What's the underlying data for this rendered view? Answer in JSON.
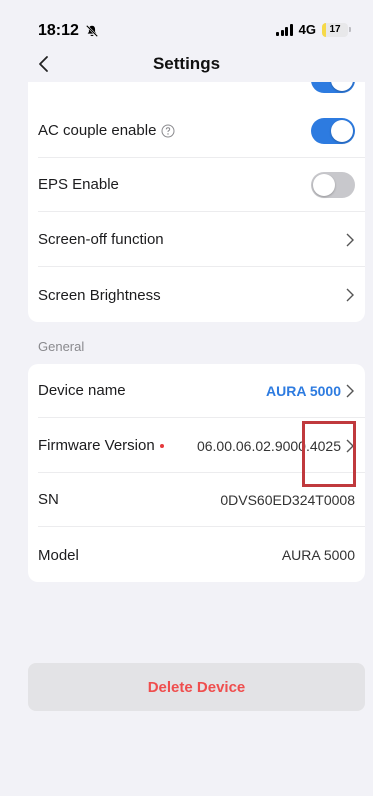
{
  "status_bar": {
    "time": "18:12",
    "network": "4G",
    "battery": "17",
    "battery_level": 0.17
  },
  "nav": {
    "title": "Settings"
  },
  "settings_top": [
    {
      "label": "AC couple enable",
      "type": "toggle",
      "on": true,
      "help": true
    },
    {
      "label": "EPS Enable",
      "type": "toggle",
      "on": false
    },
    {
      "label": "Screen-off function",
      "type": "chevron"
    },
    {
      "label": "Screen Brightness",
      "type": "chevron"
    }
  ],
  "general": {
    "header": "General",
    "device_name": {
      "label": "Device name",
      "value": "AURA 5000"
    },
    "firmware": {
      "label": "Firmware Version",
      "value": "06.00.06.02.9000.4025"
    },
    "sn": {
      "label": "SN",
      "value": "0DVS60ED324T0008"
    },
    "model": {
      "label": "Model",
      "value": "AURA 5000"
    }
  },
  "delete_button": "Delete Device",
  "colors": {
    "accent": "#2d7be0",
    "danger": "#ef4e4e",
    "highlight": "#c0393d",
    "background": "#f2f2f7"
  }
}
